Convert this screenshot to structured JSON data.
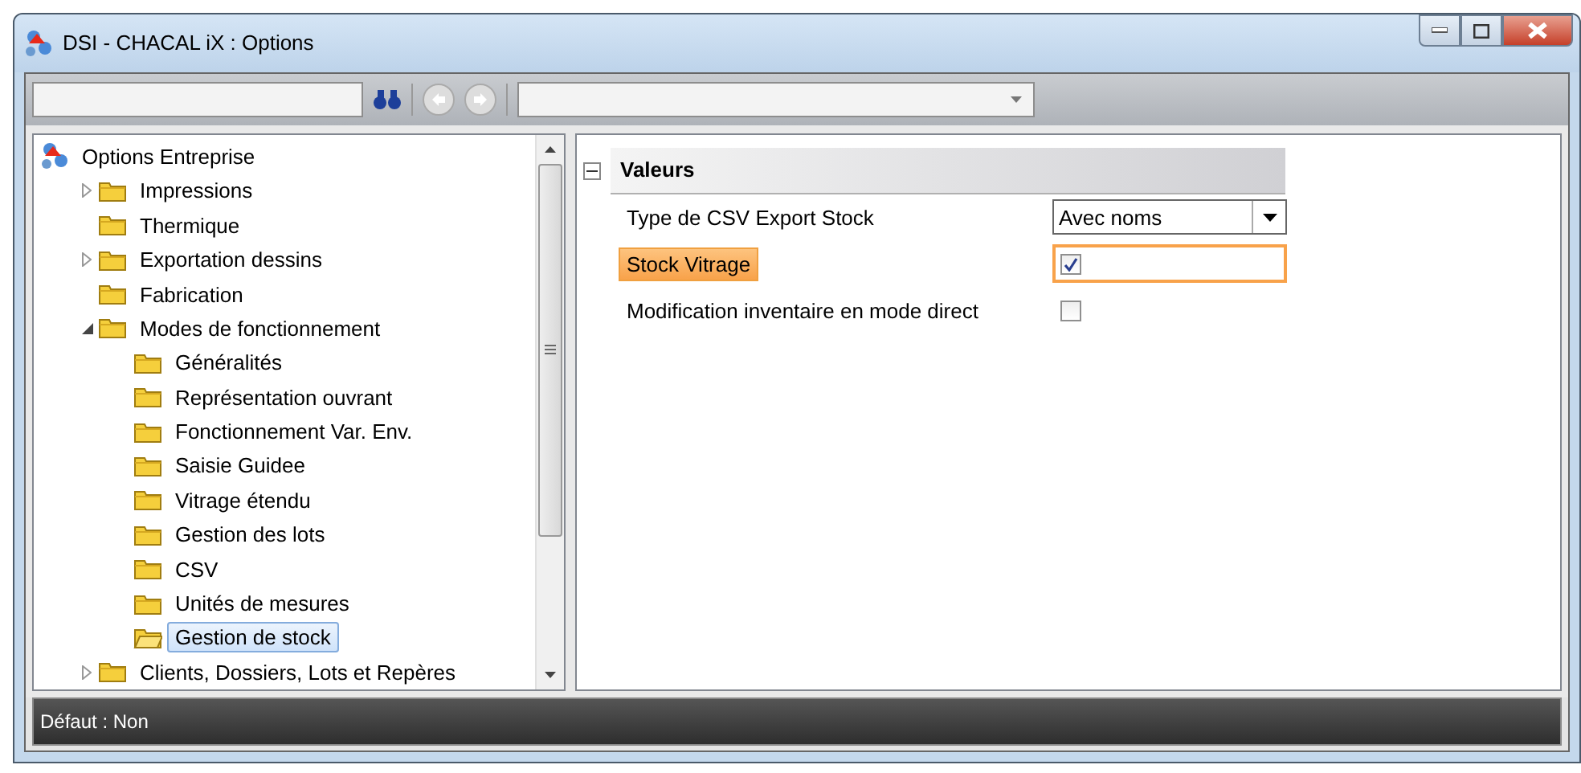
{
  "window": {
    "title": "DSI - CHACAL iX : Options"
  },
  "tree": {
    "root": {
      "label": "Options Entreprise",
      "children": [
        {
          "label": "Impressions",
          "expanded": false,
          "selected": false
        },
        {
          "label": "Thermique",
          "selected": false
        },
        {
          "label": "Exportation dessins",
          "expanded": false,
          "selected": false
        },
        {
          "label": "Fabrication",
          "selected": false
        },
        {
          "label": "Modes de fonctionnement",
          "expanded": true,
          "selected": false,
          "children": [
            {
              "label": "Généralités",
              "selected": false
            },
            {
              "label": "Représentation ouvrant",
              "selected": false
            },
            {
              "label": "Fonctionnement Var. Env.",
              "selected": false
            },
            {
              "label": "Saisie Guidee",
              "selected": false
            },
            {
              "label": "Vitrage étendu",
              "selected": false
            },
            {
              "label": "Gestion des lots",
              "selected": false
            },
            {
              "label": "CSV",
              "selected": false
            },
            {
              "label": "Unités de mesures",
              "selected": false
            },
            {
              "label": "Gestion de stock",
              "selected": true
            }
          ]
        },
        {
          "label": "Clients, Dossiers, Lots et Repères",
          "expanded": false,
          "selected": false
        }
      ]
    }
  },
  "properties": {
    "section": {
      "title": "Valeurs",
      "expanded": true
    },
    "rows": [
      {
        "label": "Type de CSV Export Stock",
        "kind": "dropdown",
        "value": "Avec noms",
        "selected": false
      },
      {
        "label": "Stock Vitrage",
        "kind": "checkbox",
        "checked": true,
        "selected": true
      },
      {
        "label": "Modification inventaire en mode direct",
        "kind": "checkbox",
        "checked": false,
        "selected": false
      }
    ]
  },
  "status_bar": {
    "text": "Défaut : Non"
  }
}
